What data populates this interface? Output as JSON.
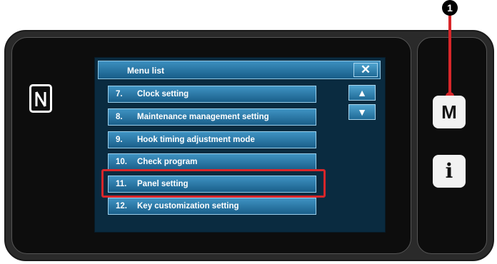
{
  "callout": {
    "number": "1"
  },
  "dialog": {
    "title": "Menu list",
    "close_label": "✕",
    "scroll_up_label": "▲",
    "scroll_down_label": "▼",
    "items": [
      {
        "number": "7.",
        "label": "Clock setting"
      },
      {
        "number": "8.",
        "label": "Maintenance management setting"
      },
      {
        "number": "9.",
        "label": "Hook timing adjustment mode"
      },
      {
        "number": "10.",
        "label": "Check program"
      },
      {
        "number": "11.",
        "label": "Panel setting"
      },
      {
        "number": "12.",
        "label": "Key customization setting"
      }
    ],
    "highlighted_item": "11. Panel setting"
  },
  "side_buttons": {
    "menu_label": "M",
    "info_label": "i"
  },
  "icons": {
    "nfc": "nfc-icon",
    "close": "close-icon",
    "scroll_up": "arrow-up-icon",
    "scroll_down": "arrow-down-icon",
    "info": "info-icon"
  },
  "colors": {
    "highlight": "#d8262a",
    "button_blue": "#2a77a6",
    "dialog_bg": "#0a2b40"
  }
}
